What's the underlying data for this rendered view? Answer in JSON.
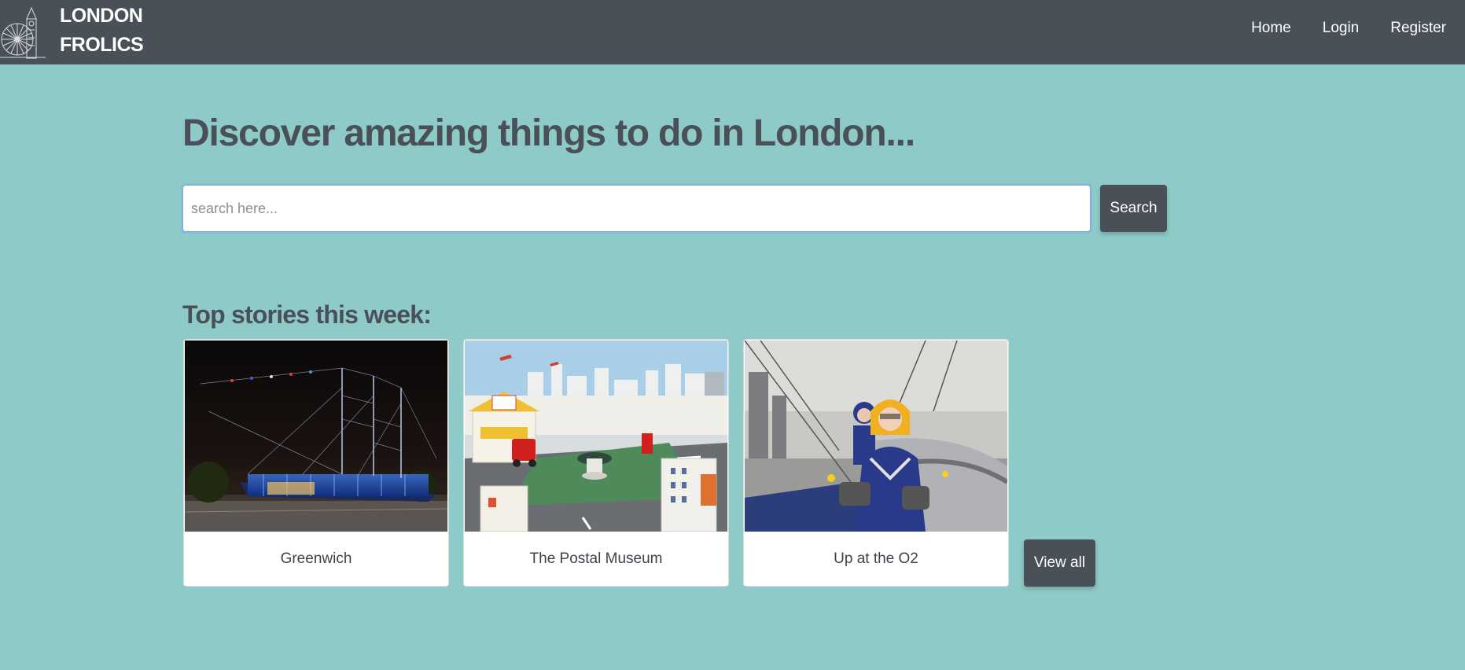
{
  "brand": {
    "line1": "LONDON",
    "line2": "FROLICS",
    "logo_icon": "big-ben-london-eye-icon"
  },
  "nav": {
    "items": [
      {
        "label": "Home"
      },
      {
        "label": "Login"
      },
      {
        "label": "Register"
      }
    ]
  },
  "hero": {
    "headline": "Discover amazing things to do in London...",
    "search_placeholder": "search here...",
    "search_value": "",
    "search_button": "Search"
  },
  "stories": {
    "title": "Top stories this week:",
    "cards": [
      {
        "label": "Greenwich",
        "image": "cutty-sark-night-photo"
      },
      {
        "label": "The Postal Museum",
        "image": "postal-museum-play-area-photo"
      },
      {
        "label": "Up at the O2",
        "image": "o2-roof-climb-photo"
      }
    ],
    "view_all": "View all"
  },
  "colors": {
    "navbar": "#4a5058",
    "background": "#8ecac7",
    "button": "#4a5058",
    "text": "#4a5058"
  }
}
